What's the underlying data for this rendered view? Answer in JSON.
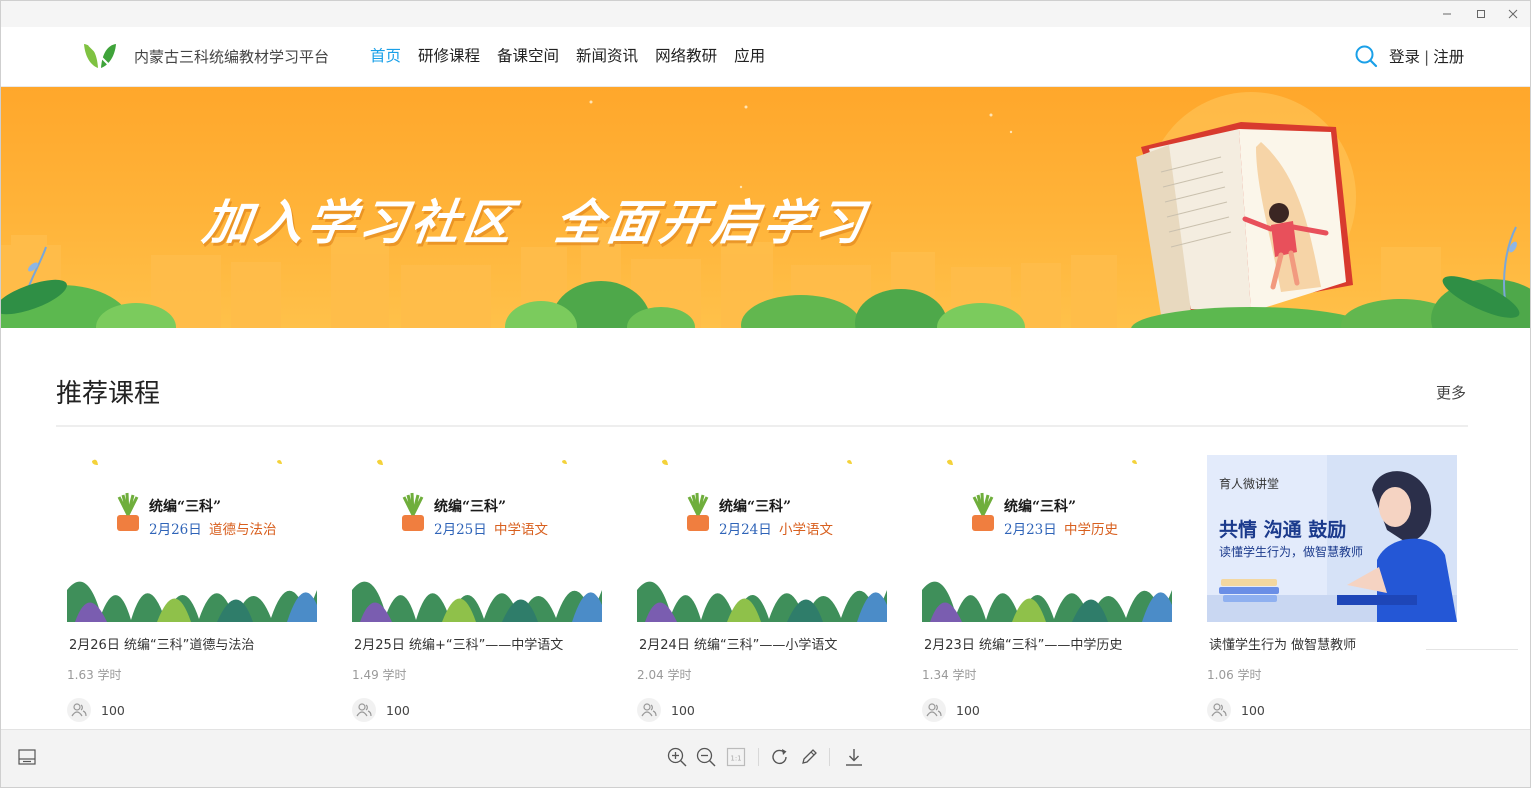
{
  "window": {
    "controls": [
      "minimize",
      "maximize",
      "close"
    ]
  },
  "header": {
    "brand": "内蒙古三科统编教材学习平台",
    "nav": [
      {
        "label": "首页",
        "active": true
      },
      {
        "label": "研修课程",
        "active": false
      },
      {
        "label": "备课空间",
        "active": false
      },
      {
        "label": "新闻资讯",
        "active": false
      },
      {
        "label": "网络教研",
        "active": false
      },
      {
        "label": "应用",
        "active": false
      }
    ],
    "search_icon": "search-icon",
    "login": "登录",
    "separator": "|",
    "register": "注册"
  },
  "banner": {
    "slogan_1": "加入学习社区",
    "slogan_2": "全面开启学习"
  },
  "section": {
    "title": "推荐课程",
    "more": "更多"
  },
  "courses": [
    {
      "thumb_head": "统编“三科”",
      "thumb_date": "2月26日",
      "thumb_subject": "道德与法治",
      "title": "2月26日 统编“三科”道德与法治",
      "hours": "1.63 学时",
      "count": "100"
    },
    {
      "thumb_head": "统编“三科”",
      "thumb_date": "2月25日",
      "thumb_subject": "中学语文",
      "title": "2月25日 统编+“三科”——中学语文",
      "hours": "1.49 学时",
      "count": "100"
    },
    {
      "thumb_head": "统编“三科”",
      "thumb_date": "2月24日",
      "thumb_subject": "小学语文",
      "title": "2月24日 统编“三科”——小学语文",
      "hours": "2.04 学时",
      "count": "100"
    },
    {
      "thumb_head": "统编“三科”",
      "thumb_date": "2月23日",
      "thumb_subject": "中学历史",
      "title": "2月23日 统编“三科”——中学历史",
      "hours": "1.34 学时",
      "count": "100"
    },
    {
      "thumb_small": "育人微讲堂",
      "thumb_big": "共情 沟通 鼓励",
      "thumb_sub": "读懂学生行为，做智慧教师",
      "title": "读懂学生行为 做智慧教师",
      "hours": "1.06 学时",
      "count": "100"
    }
  ],
  "toolbar": {
    "icons": [
      "panel-icon",
      "zoom-in-icon",
      "zoom-out-icon",
      "actual-size-icon",
      "rotate-icon",
      "edit-icon",
      "download-icon"
    ],
    "actual_size_label": "1:1"
  },
  "colors": {
    "accent": "#1aa0e8",
    "banner": "#ffad33",
    "date_blue": "#2f64b8",
    "subject_orange": "#d85f1e"
  }
}
